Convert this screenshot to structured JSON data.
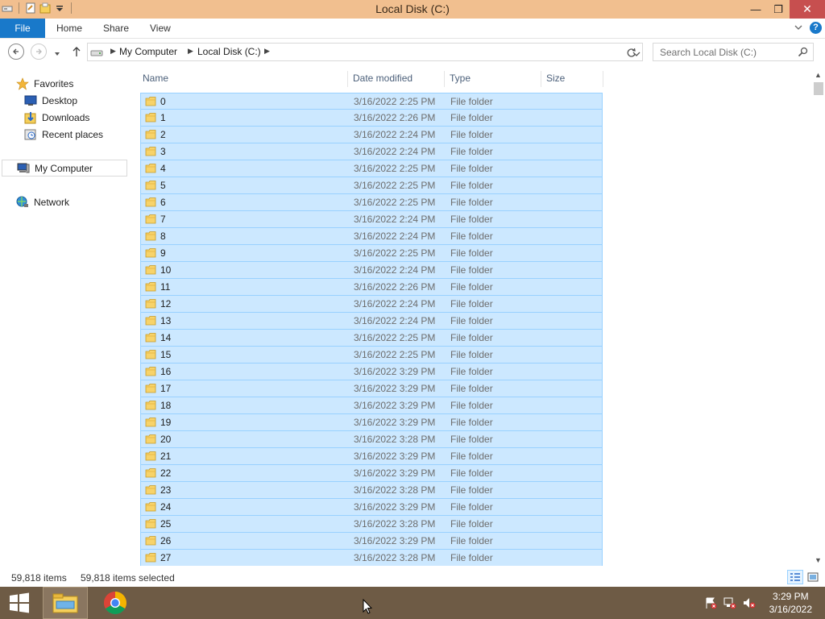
{
  "window": {
    "title": "Local Disk (C:)",
    "minimize_glyph": "—",
    "restore_glyph": "❐",
    "close_glyph": "✕"
  },
  "ribbon": {
    "file": "File",
    "tabs": [
      "Home",
      "Share",
      "View"
    ],
    "help": "?"
  },
  "address": {
    "crumbs": [
      "My Computer",
      "Local Disk (C:)"
    ],
    "search_placeholder": "Search Local Disk (C:)"
  },
  "nav": {
    "favorites": "Favorites",
    "desktop": "Desktop",
    "downloads": "Downloads",
    "recent": "Recent places",
    "computer": "My Computer",
    "network": "Network"
  },
  "columns": {
    "name": "Name",
    "date": "Date modified",
    "type": "Type",
    "size": "Size"
  },
  "files": [
    {
      "name": "0",
      "date": "3/16/2022 2:25 PM",
      "type": "File folder"
    },
    {
      "name": "1",
      "date": "3/16/2022 2:26 PM",
      "type": "File folder"
    },
    {
      "name": "2",
      "date": "3/16/2022 2:24 PM",
      "type": "File folder"
    },
    {
      "name": "3",
      "date": "3/16/2022 2:24 PM",
      "type": "File folder"
    },
    {
      "name": "4",
      "date": "3/16/2022 2:25 PM",
      "type": "File folder"
    },
    {
      "name": "5",
      "date": "3/16/2022 2:25 PM",
      "type": "File folder"
    },
    {
      "name": "6",
      "date": "3/16/2022 2:25 PM",
      "type": "File folder"
    },
    {
      "name": "7",
      "date": "3/16/2022 2:24 PM",
      "type": "File folder"
    },
    {
      "name": "8",
      "date": "3/16/2022 2:24 PM",
      "type": "File folder"
    },
    {
      "name": "9",
      "date": "3/16/2022 2:25 PM",
      "type": "File folder"
    },
    {
      "name": "10",
      "date": "3/16/2022 2:24 PM",
      "type": "File folder"
    },
    {
      "name": "11",
      "date": "3/16/2022 2:26 PM",
      "type": "File folder"
    },
    {
      "name": "12",
      "date": "3/16/2022 2:24 PM",
      "type": "File folder"
    },
    {
      "name": "13",
      "date": "3/16/2022 2:24 PM",
      "type": "File folder"
    },
    {
      "name": "14",
      "date": "3/16/2022 2:25 PM",
      "type": "File folder"
    },
    {
      "name": "15",
      "date": "3/16/2022 2:25 PM",
      "type": "File folder"
    },
    {
      "name": "16",
      "date": "3/16/2022 3:29 PM",
      "type": "File folder"
    },
    {
      "name": "17",
      "date": "3/16/2022 3:29 PM",
      "type": "File folder"
    },
    {
      "name": "18",
      "date": "3/16/2022 3:29 PM",
      "type": "File folder"
    },
    {
      "name": "19",
      "date": "3/16/2022 3:29 PM",
      "type": "File folder"
    },
    {
      "name": "20",
      "date": "3/16/2022 3:28 PM",
      "type": "File folder"
    },
    {
      "name": "21",
      "date": "3/16/2022 3:29 PM",
      "type": "File folder"
    },
    {
      "name": "22",
      "date": "3/16/2022 3:29 PM",
      "type": "File folder"
    },
    {
      "name": "23",
      "date": "3/16/2022 3:28 PM",
      "type": "File folder"
    },
    {
      "name": "24",
      "date": "3/16/2022 3:29 PM",
      "type": "File folder"
    },
    {
      "name": "25",
      "date": "3/16/2022 3:28 PM",
      "type": "File folder"
    },
    {
      "name": "26",
      "date": "3/16/2022 3:29 PM",
      "type": "File folder"
    },
    {
      "name": "27",
      "date": "3/16/2022 3:28 PM",
      "type": "File folder"
    }
  ],
  "status": {
    "items": "59,818 items",
    "selected": "59,818 items selected"
  },
  "taskbar": {
    "time": "3:29 PM",
    "date": "3/16/2022"
  },
  "colors": {
    "titlebar": "#f1bf8f",
    "accent": "#1979ca",
    "selection": "#cce8ff",
    "taskbar": "#6e5b45"
  }
}
